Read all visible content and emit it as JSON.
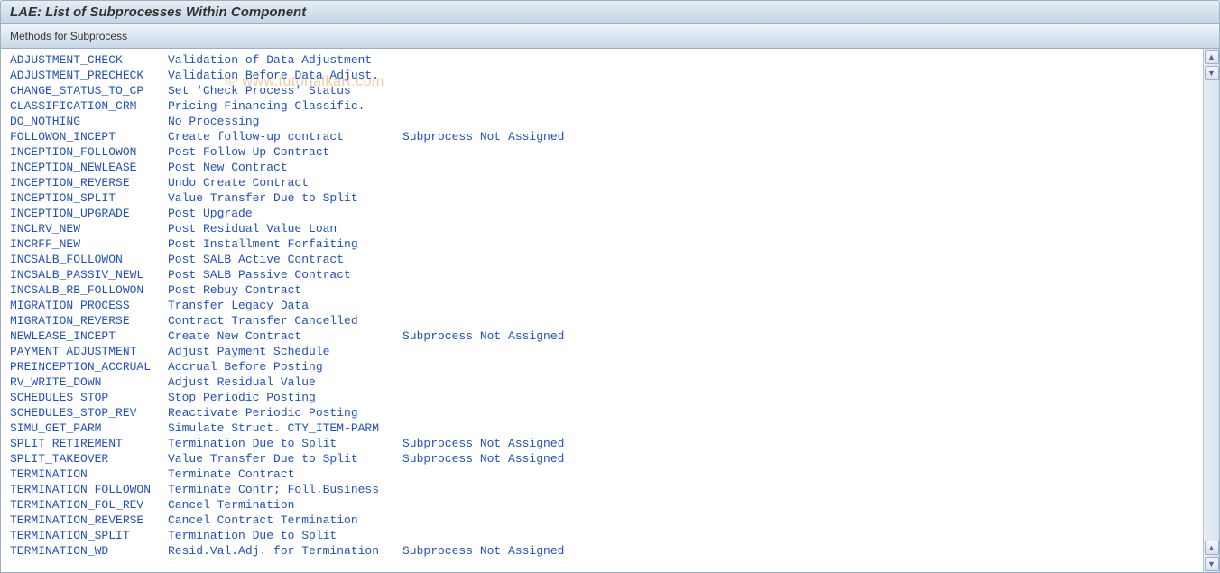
{
  "header": {
    "title": "LAE: List of Subprocesses Within Component"
  },
  "toolbar": {
    "methods_label": "Methods for Subprocess"
  },
  "watermark": "© www.tutorialkart.com",
  "rows": [
    {
      "code": "ADJUSTMENT_CHECK",
      "desc": "Validation of Data Adjustment",
      "status": ""
    },
    {
      "code": "ADJUSTMENT_PRECHECK",
      "desc": "Validation Before Data Adjust.",
      "status": ""
    },
    {
      "code": "CHANGE_STATUS_TO_CP",
      "desc": "Set 'Check Process' Status",
      "status": ""
    },
    {
      "code": "CLASSIFICATION_CRM",
      "desc": "Pricing Financing Classific.",
      "status": ""
    },
    {
      "code": "DO_NOTHING",
      "desc": "No Processing",
      "status": ""
    },
    {
      "code": "FOLLOWON_INCEPT",
      "desc": "Create follow-up contract",
      "status": "Subprocess Not Assigned"
    },
    {
      "code": "INCEPTION_FOLLOWON",
      "desc": "Post Follow-Up Contract",
      "status": ""
    },
    {
      "code": "INCEPTION_NEWLEASE",
      "desc": "Post New Contract",
      "status": ""
    },
    {
      "code": "INCEPTION_REVERSE",
      "desc": "Undo Create Contract",
      "status": ""
    },
    {
      "code": "INCEPTION_SPLIT",
      "desc": "Value Transfer Due to Split",
      "status": ""
    },
    {
      "code": "INCEPTION_UPGRADE",
      "desc": "Post Upgrade",
      "status": ""
    },
    {
      "code": "INCLRV_NEW",
      "desc": "Post Residual Value Loan",
      "status": ""
    },
    {
      "code": "INCRFF_NEW",
      "desc": "Post Installment Forfaiting",
      "status": ""
    },
    {
      "code": "INCSALB_FOLLOWON",
      "desc": "Post SALB Active Contract",
      "status": ""
    },
    {
      "code": "INCSALB_PASSIV_NEWL",
      "desc": "Post SALB Passive Contract",
      "status": ""
    },
    {
      "code": "INCSALB_RB_FOLLOWON",
      "desc": "Post Rebuy Contract",
      "status": ""
    },
    {
      "code": "MIGRATION_PROCESS",
      "desc": "Transfer Legacy Data",
      "status": ""
    },
    {
      "code": "MIGRATION_REVERSE",
      "desc": "Contract Transfer Cancelled",
      "status": ""
    },
    {
      "code": "NEWLEASE_INCEPT",
      "desc": "Create New Contract",
      "status": "Subprocess Not Assigned"
    },
    {
      "code": "PAYMENT_ADJUSTMENT",
      "desc": "Adjust Payment Schedule",
      "status": ""
    },
    {
      "code": "PREINCEPTION_ACCRUAL",
      "desc": "Accrual Before Posting",
      "status": ""
    },
    {
      "code": "RV_WRITE_DOWN",
      "desc": "Adjust Residual Value",
      "status": ""
    },
    {
      "code": "SCHEDULES_STOP",
      "desc": "Stop Periodic Posting",
      "status": ""
    },
    {
      "code": "SCHEDULES_STOP_REV",
      "desc": "Reactivate Periodic Posting",
      "status": ""
    },
    {
      "code": "SIMU_GET_PARM",
      "desc": "Simulate Struct. CTY_ITEM-PARM",
      "status": ""
    },
    {
      "code": "SPLIT_RETIREMENT",
      "desc": "Termination Due to Split",
      "status": "Subprocess Not Assigned"
    },
    {
      "code": "SPLIT_TAKEOVER",
      "desc": "Value Transfer Due to Split",
      "status": "Subprocess Not Assigned"
    },
    {
      "code": "TERMINATION",
      "desc": "Terminate Contract",
      "status": ""
    },
    {
      "code": "TERMINATION_FOLLOWON",
      "desc": "Terminate Contr; Foll.Business",
      "status": ""
    },
    {
      "code": "TERMINATION_FOL_REV",
      "desc": "Cancel Termination",
      "status": ""
    },
    {
      "code": "TERMINATION_REVERSE",
      "desc": "Cancel Contract Termination",
      "status": ""
    },
    {
      "code": "TERMINATION_SPLIT",
      "desc": "Termination Due to Split",
      "status": ""
    },
    {
      "code": "TERMINATION_WD",
      "desc": "Resid.Val.Adj. for Termination",
      "status": "Subprocess Not Assigned"
    }
  ],
  "scroll": {
    "up": "▲",
    "down": "▼"
  }
}
